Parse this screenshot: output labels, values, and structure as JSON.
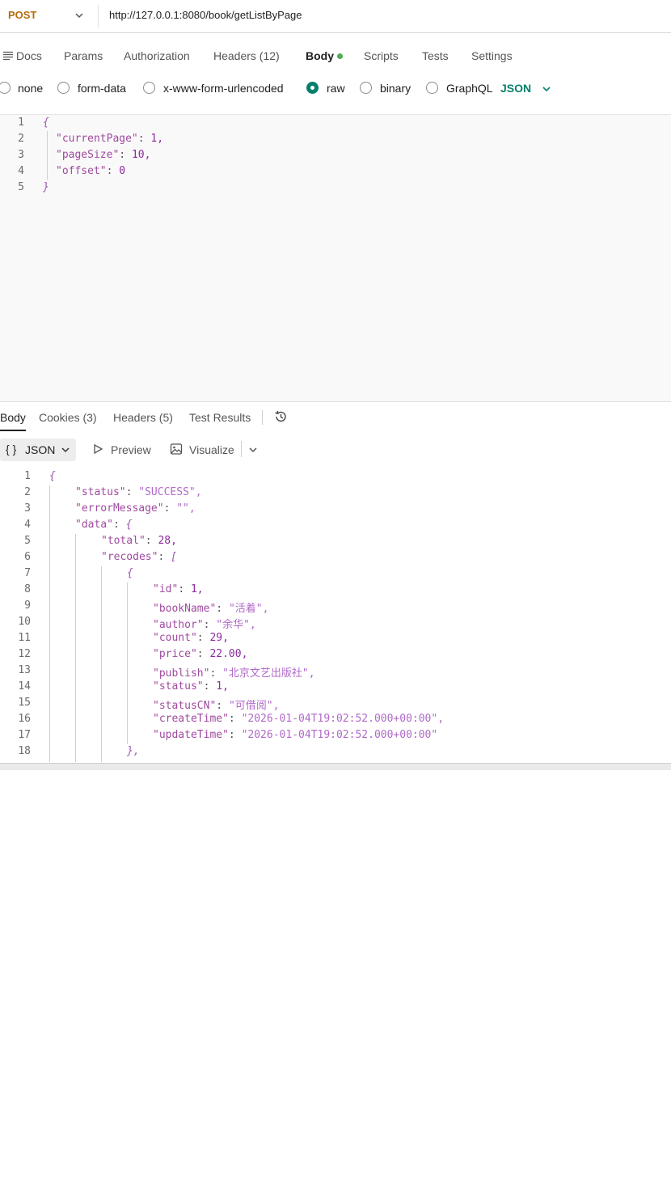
{
  "request": {
    "method": "POST",
    "url": "http://127.0.0.1:8080/book/getListByPage"
  },
  "request_tabs": {
    "docs": "Docs",
    "params": "Params",
    "authorization": "Authorization",
    "headers": "Headers (12)",
    "body": "Body",
    "scripts": "Scripts",
    "tests": "Tests",
    "settings": "Settings"
  },
  "body_types": {
    "none": "none",
    "form_data": "form-data",
    "urlencoded": "x-www-form-urlencoded",
    "raw": "raw",
    "binary": "binary",
    "graphql": "GraphQL",
    "selected": "raw",
    "language": "JSON"
  },
  "request_body_lines": [
    {
      "num": "1",
      "text": "{"
    },
    {
      "num": "2",
      "key": "\"currentPage\"",
      "val": "1,"
    },
    {
      "num": "3",
      "key": "\"pageSize\"",
      "val": "10,"
    },
    {
      "num": "4",
      "key": "\"offset\"",
      "val": "0"
    },
    {
      "num": "5",
      "text": "}"
    }
  ],
  "response_tabs": {
    "body": "Body",
    "cookies": "Cookies (3)",
    "headers": "Headers (5)",
    "test_results": "Test Results"
  },
  "response_toolbar": {
    "format_braces": "{ }",
    "format": "JSON",
    "preview": "Preview",
    "visualize": "Visualize"
  },
  "response_body_lines": [
    {
      "num": "1",
      "text": "{"
    },
    {
      "num": "2",
      "key": "\"status\"",
      "sval": "\"SUCCESS\","
    },
    {
      "num": "3",
      "key": "\"errorMessage\"",
      "sval": "\"\","
    },
    {
      "num": "4",
      "key": "\"data\"",
      "open": "{"
    },
    {
      "num": "5",
      "key": "\"total\"",
      "val": "28,"
    },
    {
      "num": "6",
      "key": "\"recodes\"",
      "open": "["
    },
    {
      "num": "7",
      "text": "{"
    },
    {
      "num": "8",
      "key": "\"id\"",
      "val": "1,"
    },
    {
      "num": "9",
      "key": "\"bookName\"",
      "sval": "\"活着\","
    },
    {
      "num": "10",
      "key": "\"author\"",
      "sval": "\"余华\","
    },
    {
      "num": "11",
      "key": "\"count\"",
      "val": "29,"
    },
    {
      "num": "12",
      "key": "\"price\"",
      "val": "22.00,"
    },
    {
      "num": "13",
      "key": "\"publish\"",
      "sval": "\"北京文艺出版社\","
    },
    {
      "num": "14",
      "key": "\"status\"",
      "val": "1,"
    },
    {
      "num": "15",
      "key": "\"statusCN\"",
      "sval": "\"可借阅\","
    },
    {
      "num": "16",
      "key": "\"createTime\"",
      "sval": "\"2026-01-04T19:02:52.000+00:00\","
    },
    {
      "num": "17",
      "key": "\"updateTime\"",
      "sval": "\"2026-01-04T19:02:52.000+00:00\""
    },
    {
      "num": "18",
      "text": "},"
    }
  ],
  "icons": {
    "method_dropdown": "chevron-down-icon",
    "docs": "docs-lines-icon",
    "language_dropdown": "chevron-down-icon",
    "history": "history-icon",
    "preview": "play-icon",
    "visualize": "image-icon"
  },
  "colors": {
    "method": "#b46d0e",
    "accent": "#087f6c",
    "body_dot": "#4caf50",
    "json_key": "#a04a9f",
    "json_string": "#b06ac8",
    "json_number": "#8b2c9d"
  }
}
